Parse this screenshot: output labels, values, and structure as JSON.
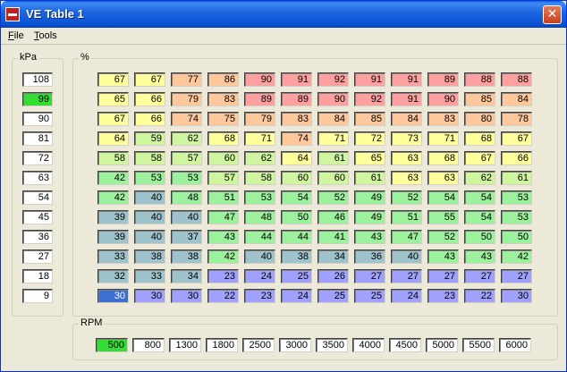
{
  "window": {
    "title": "VE Table 1",
    "close_glyph": "✕"
  },
  "menu": {
    "file": "File",
    "tools": "Tools"
  },
  "kpa_group": {
    "label": "kPa"
  },
  "grid_group": {
    "label": "%"
  },
  "rpm_group": {
    "label": "RPM"
  },
  "kpa": [
    "108",
    "99",
    "90",
    "81",
    "72",
    "63",
    "54",
    "45",
    "36",
    "27",
    "18",
    "9"
  ],
  "rpm": [
    "500",
    "800",
    "1300",
    "1800",
    "2500",
    "3000",
    "3500",
    "4000",
    "4500",
    "5000",
    "5500",
    "6000"
  ],
  "active_kpa_index": 1,
  "active_rpm_index": 0,
  "selected_cell": {
    "row": 11,
    "col": 0
  },
  "table": [
    [
      "67",
      "67",
      "77",
      "86",
      "90",
      "91",
      "92",
      "91",
      "91",
      "89",
      "88",
      "88"
    ],
    [
      "65",
      "66",
      "79",
      "83",
      "89",
      "89",
      "90",
      "92",
      "91",
      "90",
      "85",
      "84"
    ],
    [
      "67",
      "66",
      "74",
      "75",
      "79",
      "83",
      "84",
      "85",
      "84",
      "83",
      "80",
      "78"
    ],
    [
      "64",
      "59",
      "62",
      "68",
      "71",
      "74",
      "71",
      "72",
      "73",
      "71",
      "68",
      "67"
    ],
    [
      "58",
      "58",
      "57",
      "60",
      "62",
      "64",
      "61",
      "65",
      "63",
      "68",
      "67",
      "66"
    ],
    [
      "42",
      "53",
      "53",
      "57",
      "58",
      "60",
      "60",
      "61",
      "63",
      "63",
      "62",
      "61"
    ],
    [
      "42",
      "40",
      "48",
      "51",
      "53",
      "54",
      "52",
      "49",
      "52",
      "54",
      "54",
      "53"
    ],
    [
      "39",
      "40",
      "40",
      "47",
      "48",
      "50",
      "46",
      "49",
      "51",
      "55",
      "54",
      "53"
    ],
    [
      "39",
      "40",
      "37",
      "43",
      "44",
      "44",
      "41",
      "43",
      "47",
      "52",
      "50",
      "50"
    ],
    [
      "33",
      "38",
      "38",
      "42",
      "40",
      "38",
      "34",
      "36",
      "40",
      "43",
      "43",
      "42"
    ],
    [
      "32",
      "33",
      "34",
      "23",
      "24",
      "25",
      "26",
      "27",
      "27",
      "27",
      "27",
      "27"
    ],
    [
      "30",
      "30",
      "30",
      "22",
      "23",
      "24",
      "25",
      "25",
      "24",
      "23",
      "22",
      "30"
    ]
  ],
  "colors": {
    "active": "#33dd33",
    "selected": "#3c6fd2",
    "scale": [
      "#a0a0ff",
      "#9ec3cc",
      "#9cf29c",
      "#cff59e",
      "#ffff9c",
      "#ffc89c",
      "#ffa0a0"
    ]
  }
}
